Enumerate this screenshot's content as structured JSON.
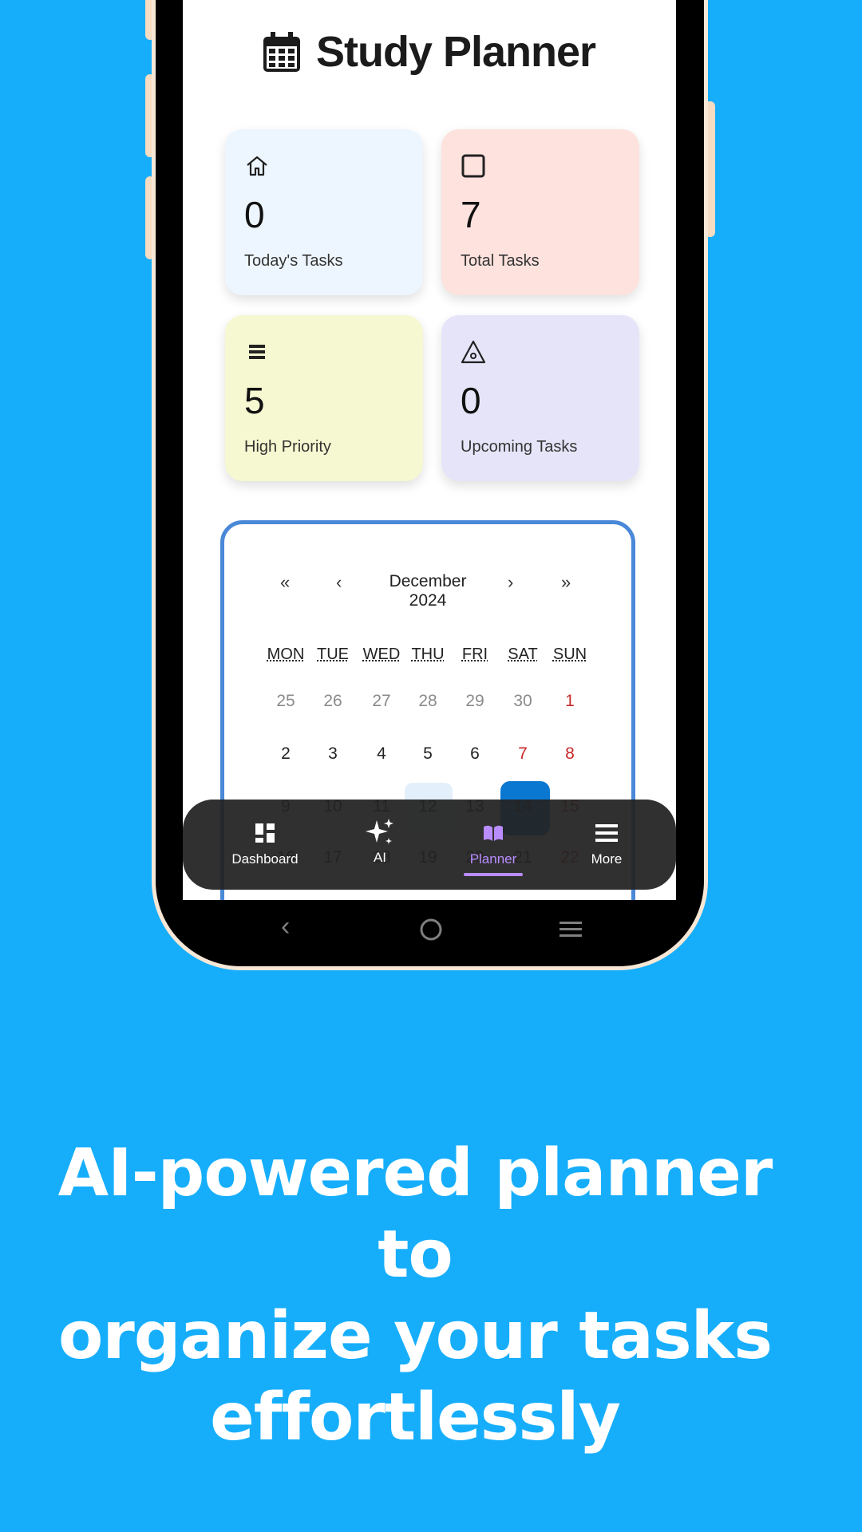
{
  "app": {
    "title": "Study Planner"
  },
  "stats": [
    {
      "icon": "home-icon",
      "value": "0",
      "label": "Today's Tasks",
      "color": "#edf6fe"
    },
    {
      "icon": "square-icon",
      "value": "7",
      "label": "Total Tasks",
      "color": "#fde2de"
    },
    {
      "icon": "list-icon",
      "value": "5",
      "label": "High Priority",
      "color": "#f6f8d1"
    },
    {
      "icon": "warning-icon",
      "value": "0",
      "label": "Upcoming Tasks",
      "color": "#e6e4f8"
    }
  ],
  "calendar": {
    "month": "December",
    "year": "2024",
    "nav": {
      "prev_year": "«",
      "prev_month": "‹",
      "next_month": "›",
      "next_year": "»"
    },
    "weekdays": [
      "MON",
      "TUE",
      "WED",
      "THU",
      "FRI",
      "SAT",
      "SUN"
    ],
    "weeks": [
      [
        "25",
        "26",
        "27",
        "28",
        "29",
        "30",
        "1"
      ],
      [
        "2",
        "3",
        "4",
        "5",
        "6",
        "7",
        "8"
      ],
      [
        "9",
        "10",
        "11",
        "12",
        "13",
        "14",
        "15"
      ],
      [
        "16",
        "17",
        "18",
        "19",
        "20",
        "21",
        "22"
      ]
    ],
    "weekend_color": "#c62828",
    "muted_color": "#8a8a8a"
  },
  "bottom_nav": [
    {
      "label": "Dashboard",
      "icon": "dashboard-icon",
      "active": false
    },
    {
      "label": "AI",
      "icon": "sparkles-icon",
      "active": false
    },
    {
      "label": "Planner",
      "icon": "book-icon",
      "active": true
    },
    {
      "label": "More",
      "icon": "menu-icon",
      "active": false
    }
  ],
  "caption": {
    "line1": "AI-powered planner to",
    "line2": "organize your tasks",
    "line3": "effortlessly"
  },
  "colors": {
    "background": "#16aefb",
    "accent": "#b98cff",
    "calendar_border": "#4a88d8"
  }
}
